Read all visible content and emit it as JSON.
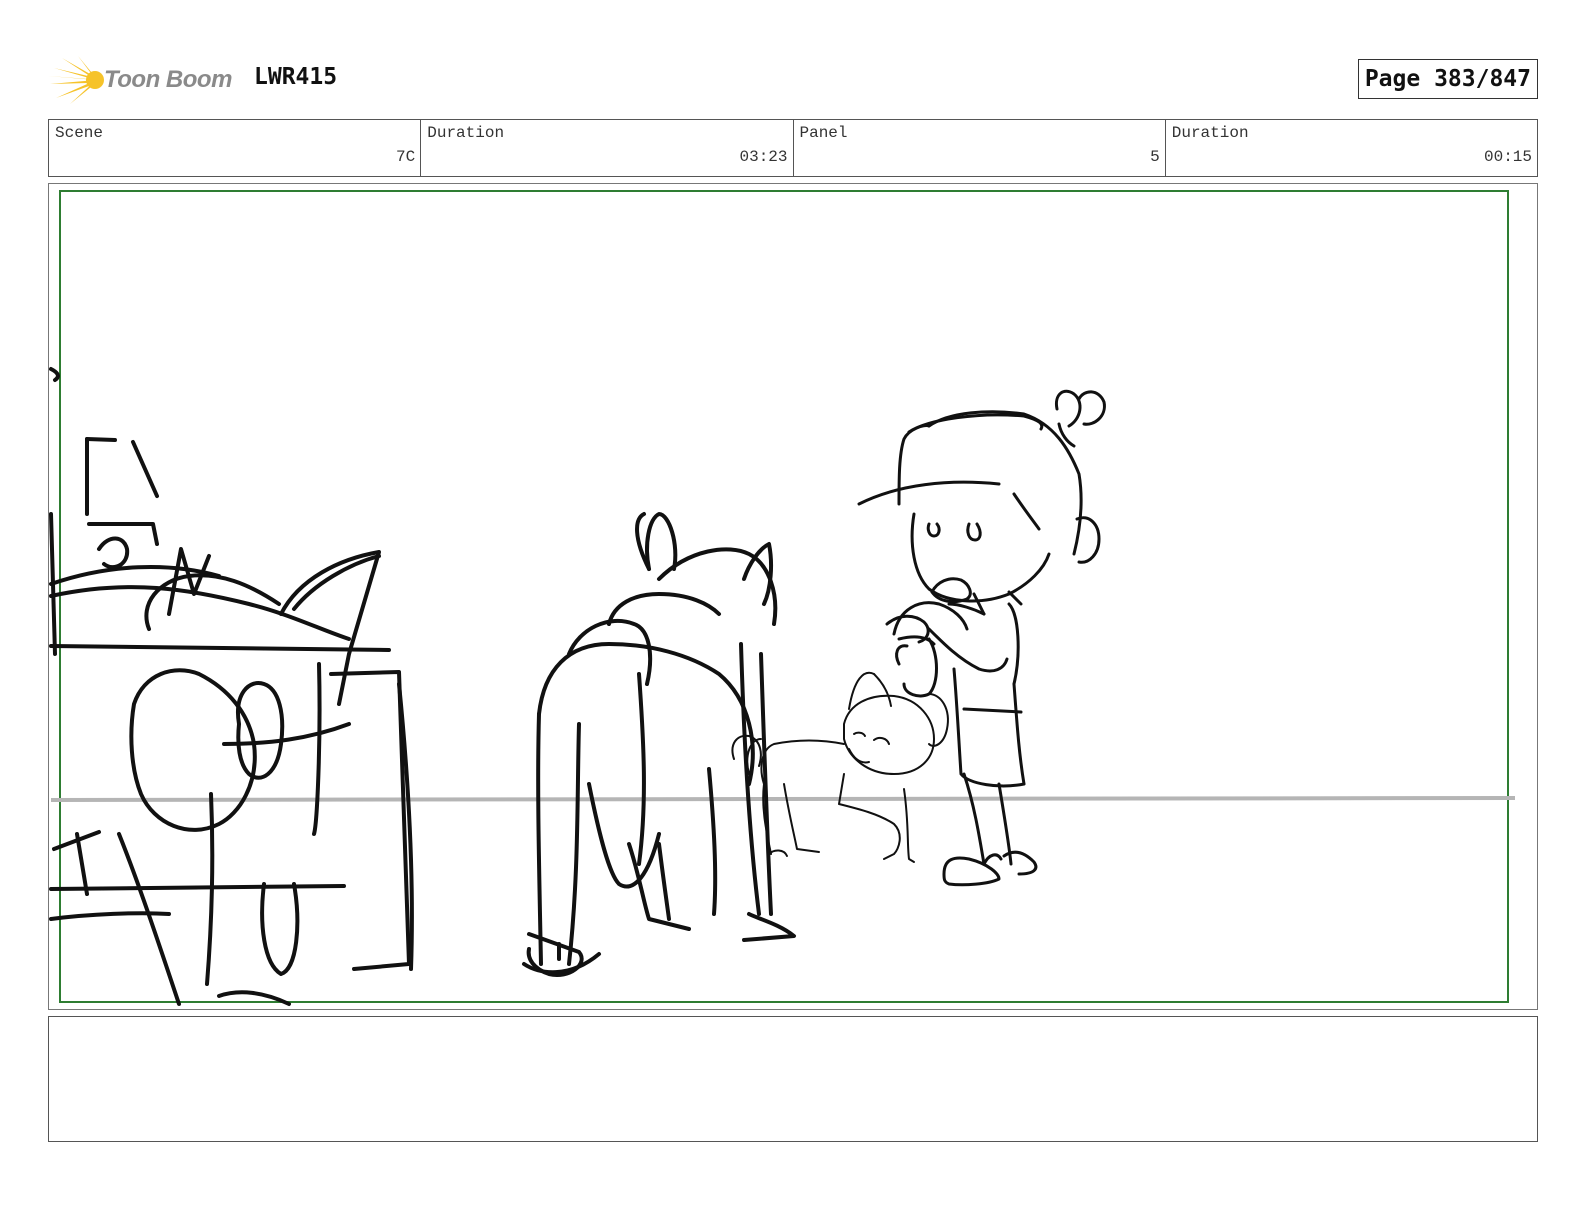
{
  "header": {
    "logo_text": "Toon Boom",
    "project_id": "LWR415",
    "page_label": "Page 383/847"
  },
  "info": {
    "scene": {
      "label": "Scene",
      "value": "7C"
    },
    "scene_duration": {
      "label": "Duration",
      "value": "03:23"
    },
    "panel": {
      "label": "Panel",
      "value": "5"
    },
    "panel_duration": {
      "label": "Duration",
      "value": "00:15"
    }
  },
  "notes": {
    "text": ""
  },
  "colors": {
    "logo_yellow": "#f6c32a",
    "safe_frame_green": "#2e7d32",
    "horizon_gray": "#b5b5b5",
    "sketch_line": "#111111"
  }
}
